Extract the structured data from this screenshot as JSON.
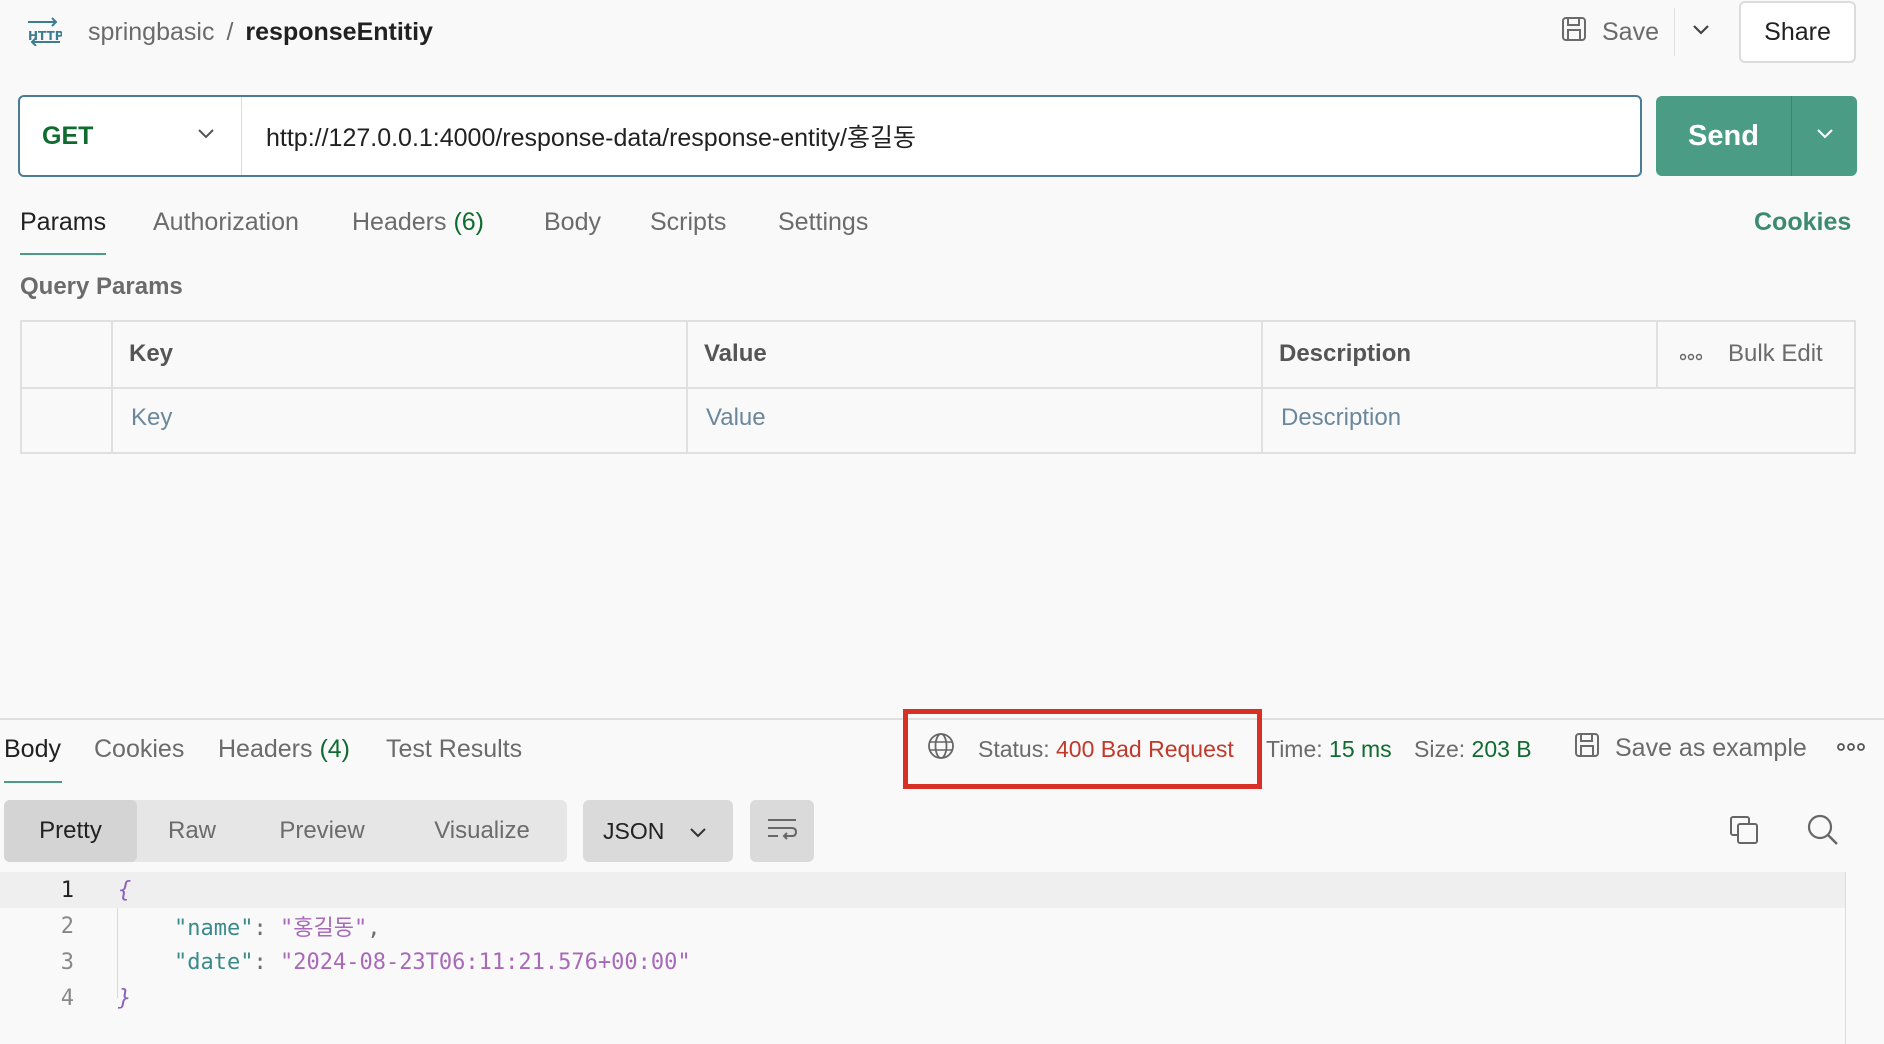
{
  "breadcrumb": {
    "parent": "springbasic",
    "separator": "/",
    "current": "responseEntitiy"
  },
  "header": {
    "save_label": "Save",
    "share_label": "Share"
  },
  "request": {
    "method": "GET",
    "url": "http://127.0.0.1:4000/response-data/response-entity/홍길동",
    "send_label": "Send"
  },
  "request_tabs": {
    "params": "Params",
    "authorization": "Authorization",
    "headers": "Headers",
    "headers_count": "(6)",
    "body": "Body",
    "scripts": "Scripts",
    "settings": "Settings",
    "cookies": "Cookies"
  },
  "query_params": {
    "title": "Query Params",
    "columns": {
      "key": "Key",
      "value": "Value",
      "description": "Description"
    },
    "bulk_edit": "Bulk Edit",
    "placeholders": {
      "key": "Key",
      "value": "Value",
      "description": "Description"
    }
  },
  "response_tabs": {
    "body": "Body",
    "cookies": "Cookies",
    "headers": "Headers",
    "headers_count": "(4)",
    "test_results": "Test Results"
  },
  "response_meta": {
    "status_label": "Status:",
    "status_value": "400 Bad Request",
    "time_label": "Time:",
    "time_value": "15 ms",
    "size_label": "Size:",
    "size_value": "203 B",
    "save_example": "Save as example"
  },
  "response_view": {
    "options": [
      "Pretty",
      "Raw",
      "Preview",
      "Visualize"
    ],
    "active": "Pretty",
    "format": "JSON"
  },
  "response_body": {
    "line_numbers": [
      "1",
      "2",
      "3",
      "4"
    ],
    "open_brace": "{",
    "close_brace": "}",
    "fields": [
      {
        "key": "\"name\"",
        "value": "\"홍길동\"",
        "trailing": ","
      },
      {
        "key": "\"date\"",
        "value": "\"2024-08-23T06:11:21.576+00:00\"",
        "trailing": ""
      }
    ]
  },
  "colors": {
    "accent": "#4a9d84",
    "method_get": "#0f6b2f",
    "status_error": "#c0392b",
    "highlight_box": "#d93025"
  },
  "icons": [
    "http-icon",
    "save-icon",
    "chevron-down-icon",
    "globe-icon",
    "more-icon",
    "copy-icon",
    "search-icon",
    "wrap-lines-icon"
  ]
}
